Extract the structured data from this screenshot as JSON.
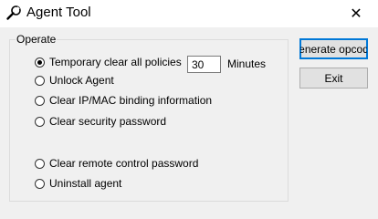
{
  "window": {
    "title": "Agent Tool",
    "icon": "wrench-icon",
    "close_glyph": "✕"
  },
  "group": {
    "legend": "Operate"
  },
  "options": [
    {
      "label": "Temporary clear all policies",
      "checked": true
    },
    {
      "label": "Unlock Agent",
      "checked": false
    },
    {
      "label": "Clear IP/MAC binding information",
      "checked": false
    },
    {
      "label": "Clear security password",
      "checked": false
    },
    {
      "label": "Clear remote control password",
      "checked": false
    },
    {
      "label": "Uninstall agent",
      "checked": false
    }
  ],
  "minutes": {
    "value": "30",
    "label": "Minutes"
  },
  "buttons": {
    "generate_label": "enerate opcod",
    "exit_label": "Exit"
  }
}
